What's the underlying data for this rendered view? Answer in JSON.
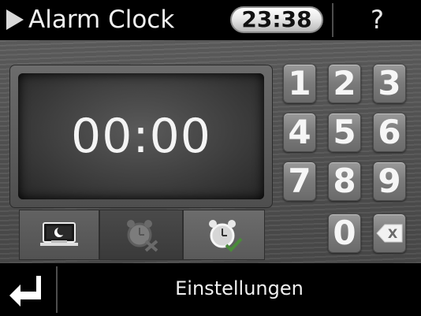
{
  "header": {
    "title": "Alarm Clock",
    "current_time": "23:38",
    "help_label": "?"
  },
  "display": {
    "alarm_time": "00:00"
  },
  "mode_tabs": [
    {
      "icon": "night-mode-icon"
    },
    {
      "icon": "alarm-off-icon"
    },
    {
      "icon": "alarm-on-icon"
    }
  ],
  "keypad": {
    "keys": [
      "1",
      "2",
      "3",
      "4",
      "5",
      "6",
      "7",
      "8",
      "9",
      "0"
    ],
    "backspace_icon": "backspace-icon",
    "backspace_label": "X"
  },
  "footer": {
    "back_icon": "back-arrow-icon",
    "settings_label": "Einstellungen"
  }
}
